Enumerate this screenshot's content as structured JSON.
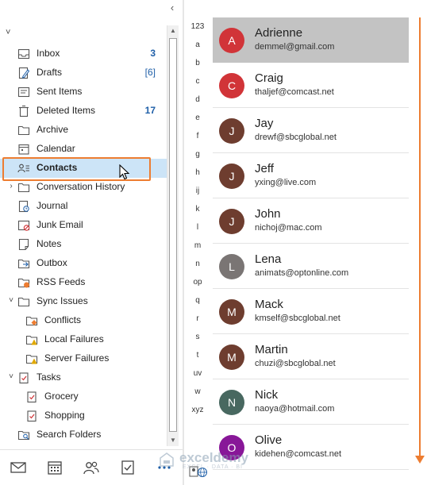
{
  "folder_pane": {
    "collapse_glyph": "‹",
    "folders": [
      {
        "label": "Inbox",
        "count": "3",
        "icon": "inbox-icon",
        "level": 0
      },
      {
        "label": "Drafts",
        "count": "[6]",
        "icon": "drafts-icon",
        "level": 0
      },
      {
        "label": "Sent Items",
        "count": "",
        "icon": "sent-icon",
        "level": 0
      },
      {
        "label": "Deleted Items",
        "count": "17",
        "icon": "trash-icon",
        "level": 0
      },
      {
        "label": "Archive",
        "count": "",
        "icon": "archive-icon",
        "level": 0
      },
      {
        "label": "Calendar",
        "count": "",
        "icon": "calendar-icon",
        "level": 0
      },
      {
        "label": "Contacts",
        "count": "",
        "icon": "contacts-icon",
        "level": 0,
        "selected": true
      },
      {
        "label": "Conversation History",
        "count": "",
        "icon": "folder-icon",
        "level": 0,
        "expand": "›"
      },
      {
        "label": "Journal",
        "count": "",
        "icon": "journal-icon",
        "level": 0
      },
      {
        "label": "Junk Email",
        "count": "",
        "icon": "junk-icon",
        "level": 0
      },
      {
        "label": "Notes",
        "count": "",
        "icon": "notes-icon",
        "level": 0
      },
      {
        "label": "Outbox",
        "count": "",
        "icon": "outbox-icon",
        "level": 0
      },
      {
        "label": "RSS Feeds",
        "count": "",
        "icon": "rss-icon",
        "level": 0
      },
      {
        "label": "Sync Issues",
        "count": "",
        "icon": "folder-icon",
        "level": 0,
        "expand": "˅"
      },
      {
        "label": "Conflicts",
        "count": "",
        "icon": "conflict-folder-icon",
        "level": 1
      },
      {
        "label": "Local Failures",
        "count": "",
        "icon": "warning-folder-icon",
        "level": 1
      },
      {
        "label": "Server Failures",
        "count": "",
        "icon": "warning-folder-icon",
        "level": 1
      },
      {
        "label": "Tasks",
        "count": "",
        "icon": "tasks-icon",
        "level": 0,
        "expand": "˅"
      },
      {
        "label": "Grocery",
        "count": "",
        "icon": "task-list-icon",
        "level": 1
      },
      {
        "label": "Shopping",
        "count": "",
        "icon": "task-list-icon",
        "level": 1
      },
      {
        "label": "Search Folders",
        "count": "",
        "icon": "search-folder-icon",
        "level": 0
      }
    ]
  },
  "index_letters": [
    "123",
    "a",
    "b",
    "c",
    "d",
    "e",
    "f",
    "g",
    "h",
    "ij",
    "k",
    "l",
    "m",
    "n",
    "op",
    "q",
    "r",
    "s",
    "t",
    "uv",
    "w",
    "xyz"
  ],
  "contacts": [
    {
      "initial": "A",
      "name": "Adrienne",
      "email": "demmel@gmail.com",
      "color": "#d13438",
      "active": true
    },
    {
      "initial": "C",
      "name": "Craig",
      "email": "thaljef@comcast.net",
      "color": "#d13438"
    },
    {
      "initial": "J",
      "name": "Jay",
      "email": "drewf@sbcglobal.net",
      "color": "#6e3d2f"
    },
    {
      "initial": "J",
      "name": "Jeff",
      "email": "yxing@live.com",
      "color": "#6e3d2f"
    },
    {
      "initial": "J",
      "name": "John",
      "email": "nichoj@mac.com",
      "color": "#6e3d2f"
    },
    {
      "initial": "L",
      "name": "Lena",
      "email": "animats@optonline.com",
      "color": "#7a7574"
    },
    {
      "initial": "M",
      "name": "Mack",
      "email": "kmself@sbcglobal.net",
      "color": "#6e3d2f"
    },
    {
      "initial": "M",
      "name": "Martin",
      "email": "chuzi@sbcglobal.net",
      "color": "#6e3d2f"
    },
    {
      "initial": "N",
      "name": "Nick",
      "email": "naoya@hotmail.com",
      "color": "#486860"
    },
    {
      "initial": "O",
      "name": "Olive",
      "email": "kidehen@comcast.net",
      "color": "#881798"
    }
  ],
  "watermark": {
    "text": "exceldemy",
    "sub": "EXCEL · DATA · BI"
  },
  "accent_color": "#ed7d31"
}
